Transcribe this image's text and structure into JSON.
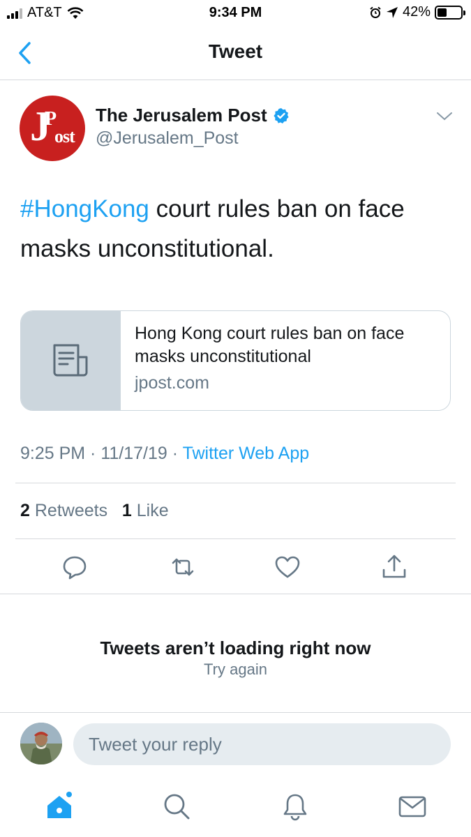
{
  "status_bar": {
    "carrier": "AT&T",
    "time": "9:34 PM",
    "battery_percent": "42%",
    "battery_level": 0.42
  },
  "nav": {
    "title": "Tweet",
    "back_icon": "chevron-left-icon"
  },
  "tweet": {
    "display_name": "The Jerusalem Post",
    "handle": "@Jerusalem_Post",
    "verified": true,
    "avatar_logo": "JPost",
    "hashtag": "#HongKong",
    "text": " court rules ban on face masks unconstitutional.",
    "card": {
      "title": "Hong Kong court rules ban on face masks unconstitutional",
      "domain": "jpost.com",
      "thumb_icon": "article-icon"
    },
    "time": "9:25 PM",
    "date": "11/17/19",
    "separator": " · ",
    "source": "Twitter Web App",
    "retweet_count": "2",
    "retweet_label": "Retweets",
    "like_count": "1",
    "like_label": "Like"
  },
  "actions": [
    "reply-icon",
    "retweet-icon",
    "like-icon",
    "share-icon"
  ],
  "timeline": {
    "error_title": "Tweets aren’t loading right now",
    "retry_label": "Try again"
  },
  "reply": {
    "placeholder": "Tweet your reply"
  },
  "tab_bar": [
    "home-icon",
    "search-icon",
    "notifications-icon",
    "messages-icon"
  ],
  "colors": {
    "accent": "#1da1f2",
    "secondary_text": "#657786",
    "jpost_red": "#c8201f"
  }
}
